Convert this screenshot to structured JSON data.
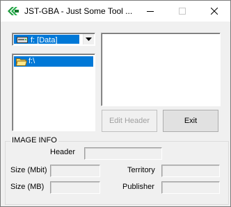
{
  "window": {
    "title": "JST-GBA - Just Some Tool ...",
    "app_icon": "green-chevron-icon",
    "controls": [
      "minimize-icon",
      "maximize-icon",
      "close-icon"
    ]
  },
  "drive_selector": {
    "selected": "f: [Data]",
    "icon": "drive-icon"
  },
  "directory_list": {
    "items": [
      {
        "label": "f:\\",
        "icon": "open-folder-icon",
        "selected": true
      }
    ]
  },
  "buttons": {
    "edit_header": "Edit Header",
    "exit": "Exit"
  },
  "image_info": {
    "title": "IMAGE INFO",
    "header_label": "Header",
    "header_value": "",
    "size_mbit_label": "Size (Mbit)",
    "size_mbit_value": "",
    "size_mb_label": "Size (MB)",
    "size_mb_value": "",
    "territory_label": "Territory",
    "territory_value": "",
    "publisher_label": "Publisher",
    "publisher_value": ""
  },
  "colors": {
    "selection": "#0078d7",
    "window_bg": "#f0f0f0",
    "icon_green": "#1e9a3c"
  }
}
